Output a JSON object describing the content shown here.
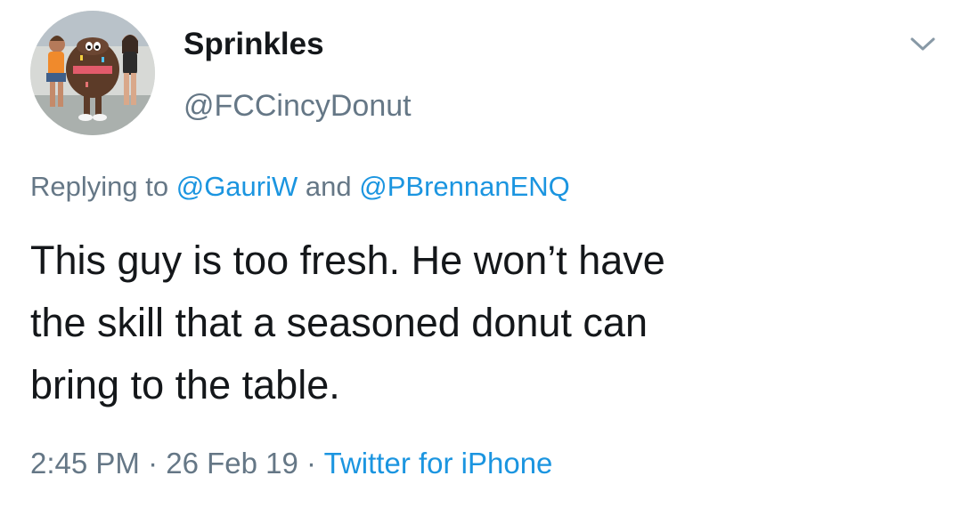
{
  "tweet": {
    "display_name": "Sprinkles",
    "handle": "@FCCincyDonut",
    "reply": {
      "prefix": "Replying to",
      "mention_1": "@GauriW",
      "joiner": "and",
      "mention_2": "@PBrennanENQ"
    },
    "text_lines": [
      "This guy is too fresh. He won’t have",
      "the skill that a seasoned donut can",
      "bring to the table."
    ],
    "time": "2:45 PM",
    "separator": "·",
    "date": "26 Feb 19",
    "source": "Twitter for iPhone"
  },
  "icons": {
    "menu": "chevron-down-icon"
  },
  "colors": {
    "text_primary": "#14171a",
    "text_secondary": "#657786",
    "link": "#1b95e0"
  }
}
